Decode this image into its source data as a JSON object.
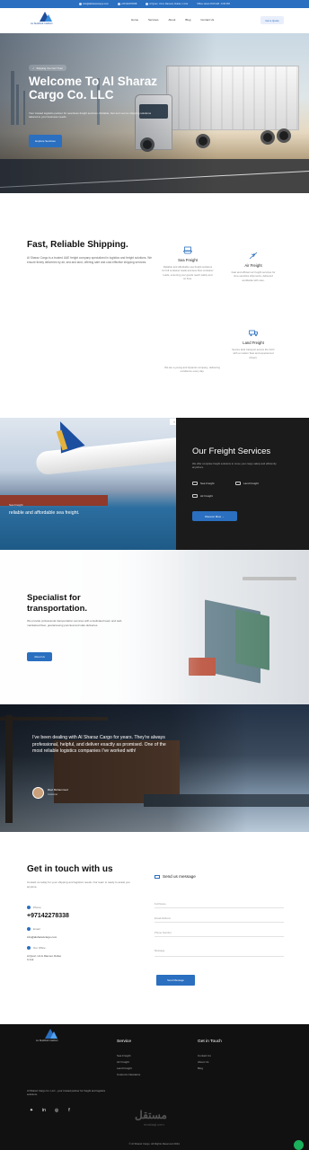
{
  "topbar": {
    "email": "info@alsharazcargo.com",
    "phone": "+97142278338",
    "address": "Al Qouz, Umm Ramool, Dubai, U.A.E",
    "hours": "Office Hours 8:00 AM - 6:00 PM"
  },
  "nav": {
    "logo_text": "AL SHARAZ CARGO",
    "items": [
      "Home",
      "Services",
      "About",
      "Blog",
      "Contact Us"
    ],
    "quote_button": "Get a Quote"
  },
  "hero": {
    "tag": "Shipping You Can Trust",
    "title": "Welcome To Al Sharaz Cargo Co. LLC",
    "subtitle": "Your trusted logistics partner for seamless freight services. Reliable, fast and secure shipping solutions tailored to your business needs.",
    "button": "Explore Services"
  },
  "shipping": {
    "title": "Fast, Reliable Shipping.",
    "description": "Al Sharaz Cargo is a trusted UAE freight company specialized in logistics and freight solutions. We ensure timely deliveries by air, sea and land, offering safe and cost-effective shipping services.",
    "services": [
      {
        "name": "Sea Freight",
        "desc": "Reliable and affordable sea freight solutions for full container loads and less than container loads, ensuring your goods reach safely and on time.",
        "icon": "ship-icon"
      },
      {
        "name": "Air Freight",
        "desc": "Fast and efficient air freight services for time-sensitive shipments, delivered worldwide with care.",
        "icon": "plane-icon"
      },
      {
        "name": "Land Freight",
        "desc": "Secure land transport across the GCC with a modern fleet and experienced drivers.",
        "icon": "truck-icon"
      }
    ],
    "footnote": "We are a young and dynamic company, delivering excellence every day."
  },
  "freight": {
    "small": "Sea Freight",
    "caption": "reliable and affordable sea freight.",
    "title": "Our Freight Services",
    "description": "We offer complete freight solutions to move your cargo safely and efficiently anywhere.",
    "items": [
      "Sea Freight",
      "Land Freight",
      "Air Freight"
    ],
    "button": "Discover More"
  },
  "specialist": {
    "title": "Specialist for transportation.",
    "description": "We provide professional transportation services with a dedicated team and well-maintained fleet, guaranteeing punctual and safe deliveries.",
    "button": "About Us"
  },
  "testimonial": {
    "quote": "I've been dealing with Al Sharaz Cargo for years. They're always professional, helpful, and deliver exactly as promised. One of the most reliable logistics companies I've worked with!",
    "name": "Ravi Mohammed",
    "role": "Customer"
  },
  "contact": {
    "title": "Get in touch with us",
    "description": "Contact us today for your shipping and logistics needs. Our team is ready to assist you anytime.",
    "phone_label": "Phone",
    "phone": "+97142278338",
    "email_label": "Email",
    "email": "info@alsharazcargo.com",
    "address_label": "Our Office",
    "address": "Al Qouz, Umm Ramool, Dubai, U.A.E"
  },
  "form": {
    "title": "Send us message",
    "fields": [
      "Full Name",
      "Email Address",
      "Phone Number",
      "Message"
    ],
    "button": "Send Message"
  },
  "footer": {
    "logo_text": "AL SHARAZ CARGO",
    "copy": "Al Sharaz Cargo Co. LLC - your trusted partner for freight and logistics solutions.",
    "service_head": "Service",
    "service_links": [
      "Sea Freight",
      "Air Freight",
      "Land Freight",
      "Customs Clearance"
    ],
    "contact_head": "Get in Touch",
    "contact_links": [
      "Contact Us",
      "About Us",
      "Blog"
    ],
    "social": [
      "twitter-icon",
      "linkedin-icon",
      "instagram-icon",
      "facebook-icon"
    ],
    "watermark": "مستقل",
    "watermark_sub": "mostaql.com",
    "rights": "© Al Sharaz Cargo. All Rights Reserved 2024."
  }
}
